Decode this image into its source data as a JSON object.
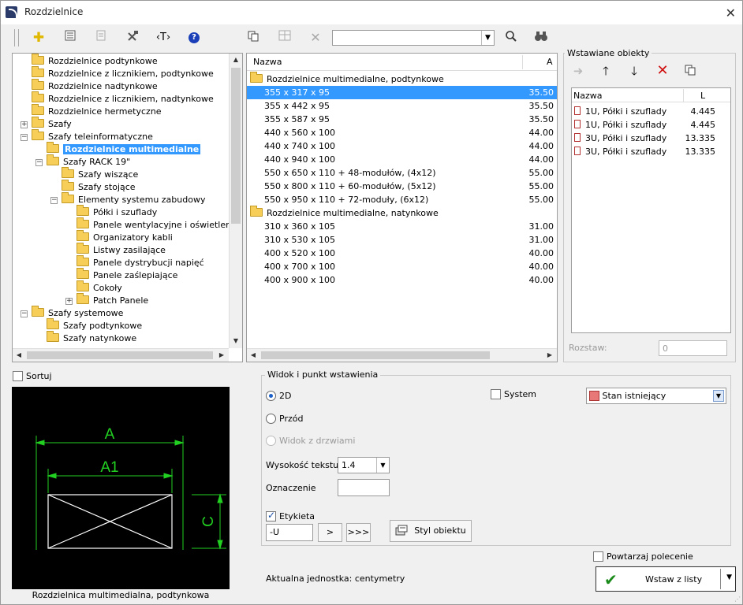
{
  "window": {
    "title": "Rozdzielnice"
  },
  "toolbar": {
    "search_value": ""
  },
  "tree": {
    "items": [
      {
        "label": "Rozdzielnice podtynkowe"
      },
      {
        "label": "Rozdzielnice z licznikiem, podtynkowe"
      },
      {
        "label": "Rozdzielnice nadtynkowe"
      },
      {
        "label": "Rozdzielnice z licznikiem, nadtynkowe"
      },
      {
        "label": "Rozdzielnice hermetyczne"
      },
      {
        "label": "Szafy"
      },
      {
        "label": "Szafy teleinformatyczne"
      },
      {
        "label": "Rozdzielnice multimedialne"
      },
      {
        "label": "Szafy RACK 19\""
      },
      {
        "label": "Szafy wiszące"
      },
      {
        "label": "Szafy stojące"
      },
      {
        "label": "Elementy systemu zabudowy"
      },
      {
        "label": "Półki i szuflady"
      },
      {
        "label": "Panele wentylacyjne i oświetleniowe"
      },
      {
        "label": "Organizatory kabli"
      },
      {
        "label": "Listwy zasilające"
      },
      {
        "label": "Panele dystrybucji napięć"
      },
      {
        "label": "Panele zaślepiające"
      },
      {
        "label": "Cokoły"
      },
      {
        "label": "Patch Panele"
      },
      {
        "label": "Szafy systemowe"
      },
      {
        "label": "Szafy podtynkowe"
      },
      {
        "label": "Szafy natynkowe"
      }
    ]
  },
  "list": {
    "col_name": "Nazwa",
    "col_a": "A",
    "groups": [
      {
        "label": "Rozdzielnice multimedialne, podtynkowe"
      },
      {
        "label": "Rozdzielnice multimedialne, natynkowe"
      }
    ],
    "rows": [
      {
        "name": "355 x 317 x 95",
        "a": "35.50"
      },
      {
        "name": "355 x 442 x 95",
        "a": "35.50"
      },
      {
        "name": "355 x 587 x 95",
        "a": "35.50"
      },
      {
        "name": "440 x 560 x 100",
        "a": "44.00"
      },
      {
        "name": "440 x 740 x 100",
        "a": "44.00"
      },
      {
        "name": "440 x 940 x 100",
        "a": "44.00"
      },
      {
        "name": "550 x 650 x 110 + 48-modułów, (4x12)",
        "a": "55.00"
      },
      {
        "name": "550 x 800 x 110 + 60-modułów, (5x12)",
        "a": "55.00"
      },
      {
        "name": "550 x 950 x 110 + 72-moduły, (6x12)",
        "a": "55.00"
      },
      {
        "name": "310 x 360 x 105",
        "a": "31.00"
      },
      {
        "name": "310 x 530 x 105",
        "a": "31.00"
      },
      {
        "name": "400 x 520 x 100",
        "a": "40.00"
      },
      {
        "name": "400 x 700 x 100",
        "a": "40.00"
      },
      {
        "name": "400 x 900 x 100",
        "a": "40.00"
      }
    ]
  },
  "inserted": {
    "title": "Wstawiane obiekty",
    "col_name": "Nazwa",
    "col_l": "L",
    "rows": [
      {
        "name": "1U, Półki i szuflady",
        "l": "4.445"
      },
      {
        "name": "1U, Półki i szuflady",
        "l": "4.445"
      },
      {
        "name": "3U, Półki i szuflady",
        "l": "13.335"
      },
      {
        "name": "3U, Półki i szuflady",
        "l": "13.335"
      }
    ],
    "spacing_label": "Rozstaw:",
    "spacing_value": "0"
  },
  "sort_label": "Sortuj",
  "preview": {
    "caption": "Rozdzielnica multimedialna, podtynkowa",
    "dim_a": "A",
    "dim_a1": "A1",
    "dim_c": "C"
  },
  "view": {
    "title": "Widok i punkt wstawienia",
    "opt_2d": "2D",
    "opt_front": "Przód",
    "opt_doors": "Widok z drzwiami",
    "system_label": "System",
    "state_value": "Stan istniejący",
    "state_color": "#e87878",
    "text_height_label": "Wysokość tekstu",
    "text_height_value": "1.4",
    "marking_label": "Oznaczenie",
    "marking_value": "",
    "label_label": "Etykieta",
    "label_value": "-U",
    "btn_next": ">",
    "btn_more": ">>>",
    "style_btn": "Styl obiektu"
  },
  "repeat_label": "Powtarzaj polecenie",
  "units_text": "Aktualna jednostka: centymetry",
  "insert_btn": "Wstaw z listy"
}
